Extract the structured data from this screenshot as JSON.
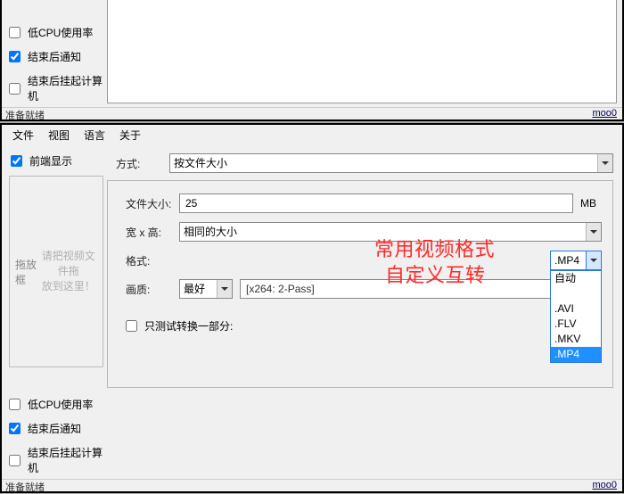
{
  "top": {
    "checks": {
      "low_cpu": "低CPU使用率",
      "notify_after": "结束后通知",
      "suspend_after": "结束后挂起计算机"
    },
    "status_left": "准备就绪",
    "status_right": "moo0"
  },
  "menu": {
    "file": "文件",
    "view": "视图",
    "language": "语言",
    "about": "关于"
  },
  "sidebar": {
    "always_on_top": "前端显示",
    "drop_legend": "拖放框",
    "drop_hint_1": "请把视频文件拖",
    "drop_hint_2": "放到这里！",
    "checks": {
      "low_cpu": "低CPU使用率",
      "notify_after": "结束后通知",
      "suspend_after": "结束后挂起计算机"
    }
  },
  "form": {
    "method_label": "方式:",
    "method_value": "按文件大小",
    "filesize_label": "文件大小:",
    "filesize_value": "25",
    "filesize_unit": "MB",
    "wh_label": "宽 x 高:",
    "wh_value": "相同的大小",
    "format_label": "格式:",
    "format_selected": ".MP4",
    "format_options": [
      "自动",
      "",
      ".AVI",
      ".FLV",
      ".MKV",
      ".MP4"
    ],
    "quality_label": "画质:",
    "quality_value": "最好",
    "quality_desc": "[x264: 2-Pass]",
    "test_only": "只测试转换一部分:"
  },
  "status": {
    "left": "准备就绪",
    "right": "moo0"
  },
  "annotation": {
    "line1": "常用视频格式",
    "line2": "自定义互转"
  }
}
